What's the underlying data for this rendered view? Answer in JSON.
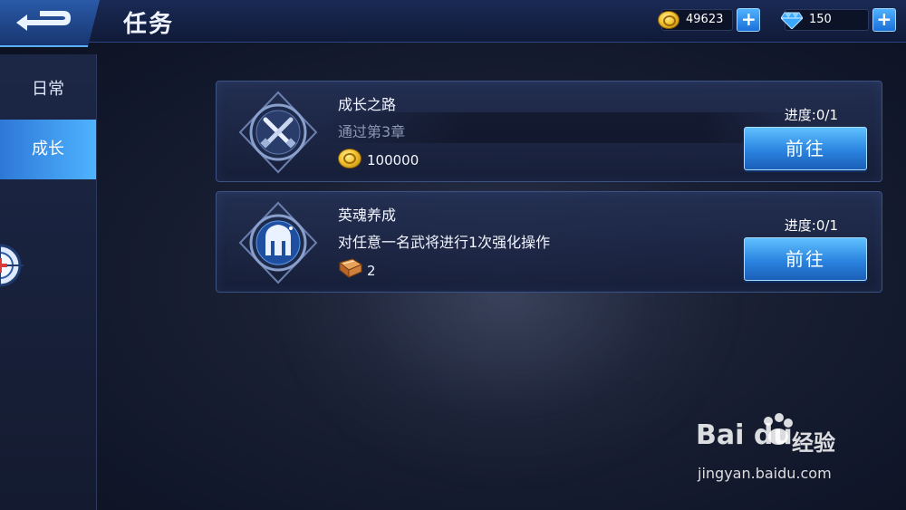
{
  "header": {
    "title": "任务",
    "gold_amount": "49623",
    "diamond_amount": "150",
    "add_label": "+"
  },
  "sidebar": {
    "items": [
      {
        "label": "日常"
      },
      {
        "label": "成长"
      }
    ],
    "active_index": 1
  },
  "tasks": [
    {
      "name": "成长之路",
      "description": "通过第3章",
      "reward_icon": "gold-coin-icon",
      "reward_value": "100000",
      "progress": "进度:0/1",
      "button_label": "前往",
      "emblem_icon": "crossed-swords-icon"
    },
    {
      "name": "英魂养成",
      "description": "对任意一名武将进行1次强化操作",
      "reward_icon": "book-icon",
      "reward_value": "2",
      "progress": "进度:0/1",
      "button_label": "前往",
      "emblem_icon": "helmet-icon"
    }
  ],
  "watermark": {
    "logo": "Bai du",
    "brand": "经验",
    "url": "jingyan.baidu.com"
  },
  "colors": {
    "accent": "#2a84e0",
    "button_light": "#5fc0ff",
    "gold": "#f3c22c",
    "diamond": "#3aa8ff"
  }
}
